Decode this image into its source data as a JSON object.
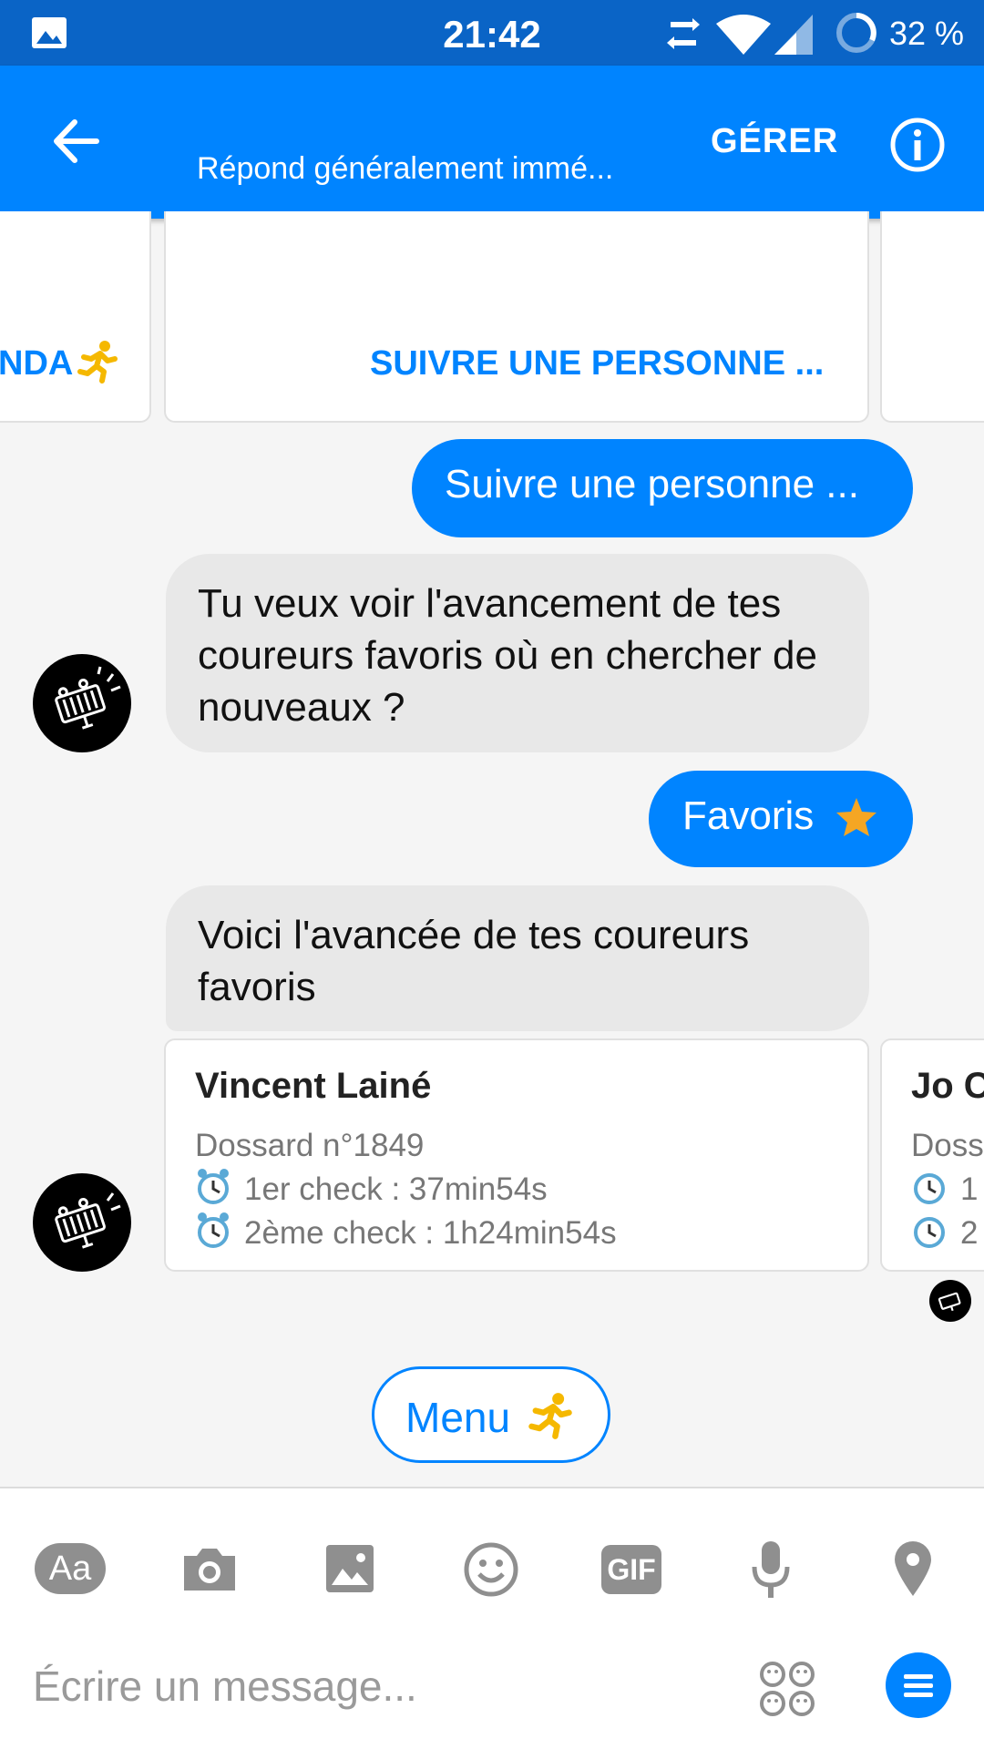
{
  "status_bar": {
    "time": "21:42",
    "battery": "32 %"
  },
  "header": {
    "subtitle": "Répond généralement immé...",
    "manage_label": "GÉRER"
  },
  "carousel_top": {
    "left_card_action": "NDA",
    "center_card_action": "SUIVRE UNE PERSONNE ..."
  },
  "messages": {
    "out1": "Suivre une personne ...",
    "in1": "Tu veux voir l'avancement de tes coureurs favoris où en chercher de nouveaux ?",
    "out2": "Favoris",
    "in2": "Voici l'avancée de tes coureurs favoris"
  },
  "runner_cards": [
    {
      "name": "Vincent Lainé",
      "bib": "Dossard n°1849",
      "check1": "1er check : 37min54s",
      "check2": "2ème check : 1h24min54s"
    },
    {
      "name": "Jo C",
      "bib": "Doss",
      "check1": "1",
      "check2": "2"
    }
  ],
  "menu_label": "Menu",
  "composer": {
    "placeholder": "Écrire un message...",
    "aa_label": "Aa",
    "gif_label": "GIF"
  },
  "colors": {
    "brand": "#0084ff",
    "status_bar": "#0a64c6",
    "runner_icon": "#f5b800",
    "star": "#f5a623"
  },
  "icons": [
    "image-icon",
    "sync-icon",
    "wifi-icon",
    "signal-icon",
    "battery-icon",
    "back-arrow-icon",
    "info-icon",
    "runner-icon",
    "star-icon",
    "alarm-clock-icon",
    "camera-icon",
    "gallery-icon",
    "smiley-icon",
    "gif-icon",
    "microphone-icon",
    "location-icon",
    "stickers-icon",
    "menu-icon"
  ]
}
